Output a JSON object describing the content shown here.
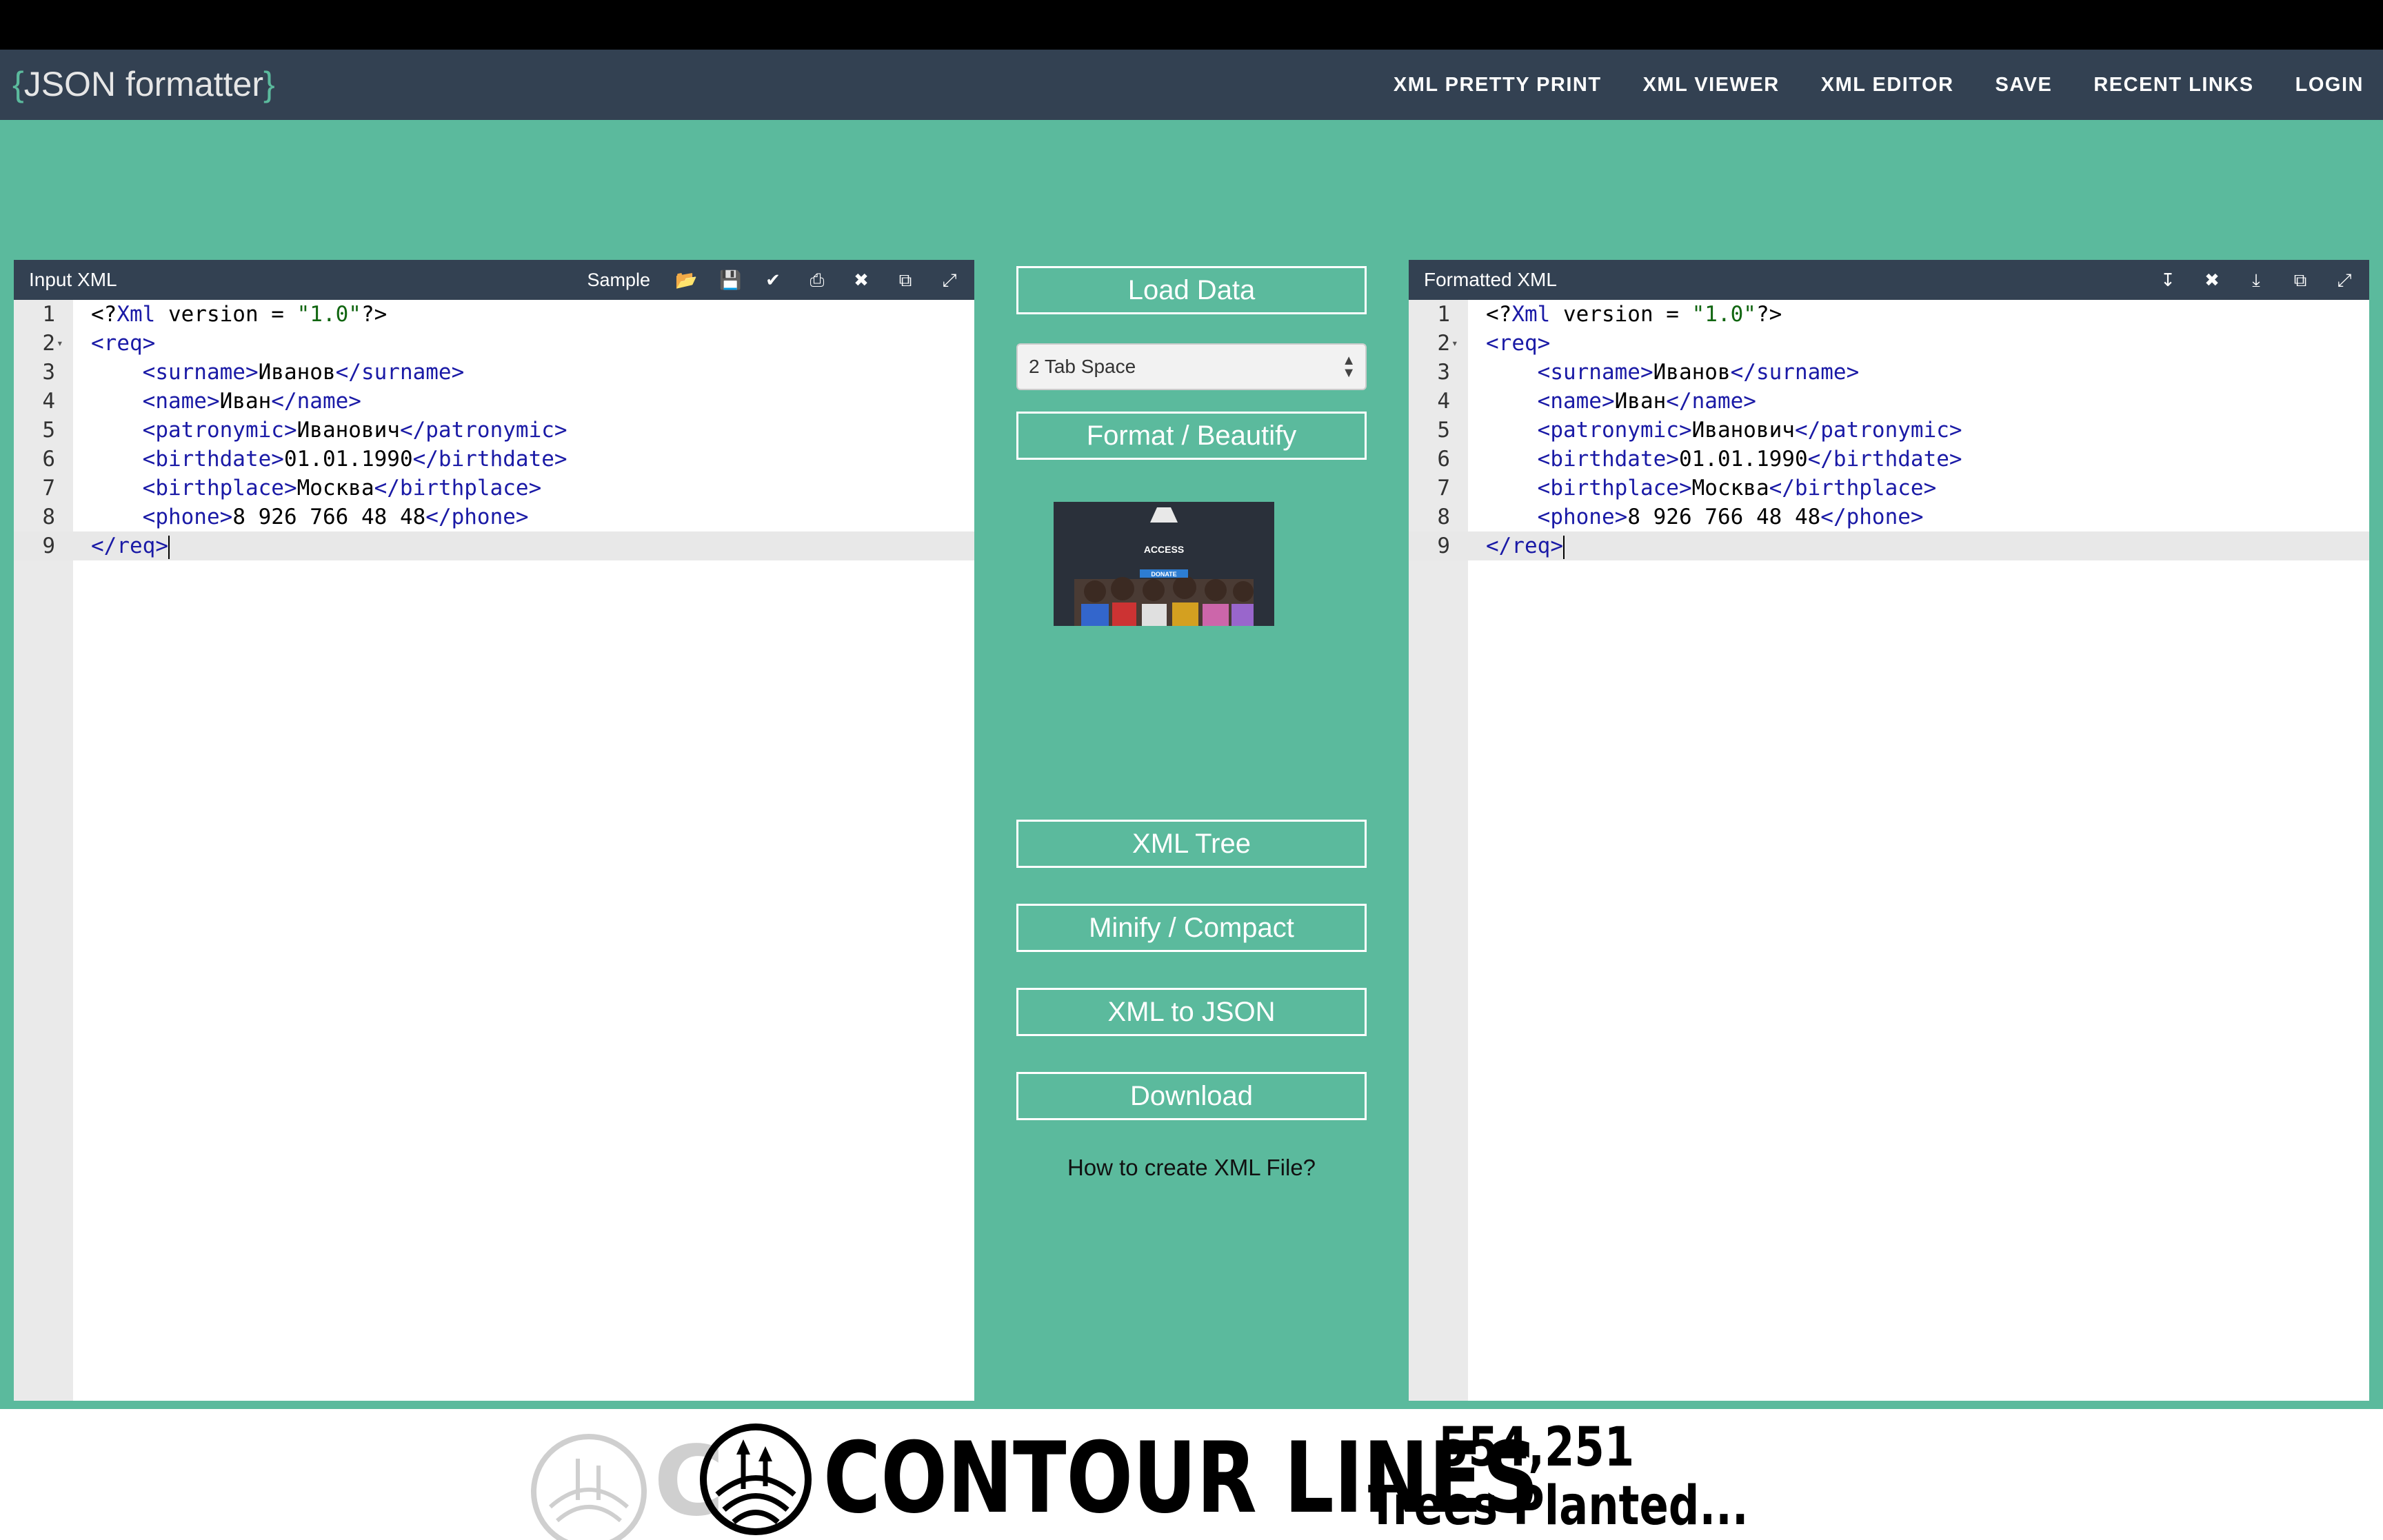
{
  "brand": {
    "open": "{",
    "name": "JSON formatter",
    "close": "}"
  },
  "nav": [
    "XML PRETTY PRINT",
    "XML VIEWER",
    "XML EDITOR",
    "SAVE",
    "RECENT LINKS",
    "LOGIN"
  ],
  "input_panel": {
    "title": "Input XML",
    "sample_label": "Sample",
    "tool_icons": [
      "folder-open-icon",
      "save-icon",
      "check-icon",
      "print-icon",
      "close-icon",
      "copy-icon",
      "expand-icon"
    ]
  },
  "output_panel": {
    "title": "Formatted XML",
    "tool_icons": [
      "collapse-icon",
      "close-icon",
      "download-icon",
      "copy-icon",
      "expand-icon"
    ]
  },
  "code_lines": [
    {
      "n": "1",
      "text": "<?Xml version = \"1.0\"?>"
    },
    {
      "n": "2",
      "text": "<req>"
    },
    {
      "n": "3",
      "text": "    <surname>Иванов</surname>"
    },
    {
      "n": "4",
      "text": "    <name>Иван</name>"
    },
    {
      "n": "5",
      "text": "    <patronymic>Иванович</patronymic>"
    },
    {
      "n": "6",
      "text": "    <birthdate>01.01.1990</birthdate>"
    },
    {
      "n": "7",
      "text": "    <birthplace>Москва</birthplace>"
    },
    {
      "n": "8",
      "text": "    <phone>8 926 766 48 48</phone>"
    },
    {
      "n": "9",
      "text": "</req>"
    }
  ],
  "center": {
    "load_data": "Load Data",
    "indent_select": "2 Tab Space",
    "format": "Format / Beautify",
    "xml_tree": "XML Tree",
    "minify": "Minify / Compact",
    "xml_to_json": "XML to JSON",
    "download": "Download",
    "howto": "How to create XML File?"
  },
  "ad": {
    "line1": "ACCESS",
    "line2": "DONATE"
  },
  "footer": {
    "brand": "CONTOUR LINES",
    "count": "554,251",
    "trees": "Trees Planted..."
  },
  "colors": {
    "accent": "#5bba9d",
    "navbar": "#334152",
    "tag": "#1a1aa6",
    "string": "#116611"
  }
}
